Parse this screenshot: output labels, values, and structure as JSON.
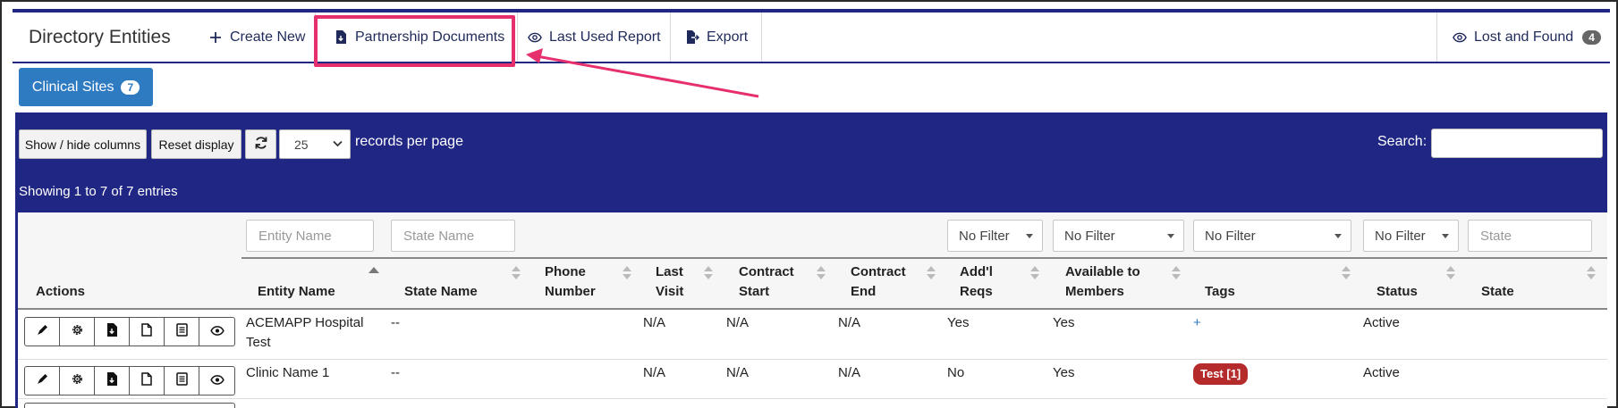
{
  "nav": {
    "title": "Directory Entities",
    "create_new": "Create New",
    "partnership_documents": "Partnership Documents",
    "last_used_report": "Last Used Report",
    "export": "Export",
    "lost_and_found": "Lost and Found",
    "lost_and_found_count": "4"
  },
  "tabs": {
    "clinical_sites": "Clinical Sites",
    "clinical_sites_count": "7"
  },
  "toolbar": {
    "show_hide_columns": "Show / hide columns",
    "reset_display": "Reset display",
    "records_per_page_value": "25",
    "records_per_page_label": "records per page",
    "search_label": "Search:",
    "showing": "Showing 1 to 7 of 7 entries"
  },
  "filters": {
    "entity_name_placeholder": "Entity Name",
    "state_name_placeholder": "State Name",
    "addl_reqs": "No Filter",
    "available": "No Filter",
    "tags": "No Filter",
    "status": "No Filter",
    "state_placeholder": "State"
  },
  "columns": {
    "actions": "Actions",
    "entity_name": "Entity Name",
    "state_name": "State Name",
    "phone_1": "Phone",
    "phone_2": "Number",
    "last_visit_1": "Last",
    "last_visit_2": "Visit",
    "contract_start_1": "Contract",
    "contract_start_2": "Start",
    "contract_end_1": "Contract",
    "contract_end_2": "End",
    "addl_reqs_1": "Add'l",
    "addl_reqs_2": "Reqs",
    "available_1": "Available to",
    "available_2": "Members",
    "tags": "Tags",
    "status": "Status",
    "state": "State"
  },
  "rows": [
    {
      "entity_name_1": "ACEMAPP Hospital",
      "entity_name_2": "Test",
      "state_name": "--",
      "phone": "",
      "last_visit": "N/A",
      "contract_start": "N/A",
      "contract_end": "N/A",
      "addl_reqs": "Yes",
      "available": "Yes",
      "tags": "+",
      "status": "Active",
      "state": ""
    },
    {
      "entity_name_1": "Clinic Name 1",
      "entity_name_2": "",
      "state_name": "--",
      "phone": "",
      "last_visit": "N/A",
      "contract_start": "N/A",
      "contract_end": "N/A",
      "addl_reqs": "No",
      "available": "Yes",
      "tags": "Test [1]",
      "status": "Active",
      "state": ""
    }
  ],
  "colors": {
    "panel_blue": "#1f2684",
    "tab_blue": "#2f7bc2",
    "annotation_pink": "#e6306d",
    "tag_red": "#b52a2a"
  }
}
